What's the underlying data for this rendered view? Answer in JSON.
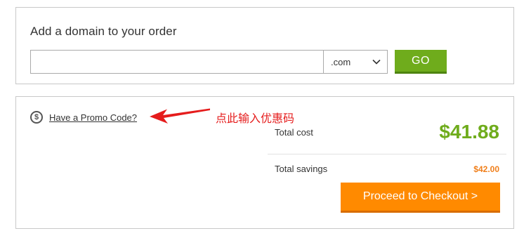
{
  "domain_search": {
    "heading": "Add a domain to your order",
    "input_value": "",
    "input_placeholder": "",
    "tld_selected": ".com",
    "go_label": "GO"
  },
  "summary": {
    "promo_icon": "dollar-circle-icon",
    "promo_link": "Have a Promo Code?",
    "annotation": "点此输入优惠码",
    "total_label": "Total cost",
    "total_value": "$41.88",
    "savings_label": "Total savings",
    "savings_value": "$42.00",
    "checkout_label": "Proceed to Checkout >"
  },
  "colors": {
    "go_green": "#6fac1c",
    "total_green": "#6fac1c",
    "savings_orange": "#f07f1b",
    "checkout_orange": "#ff8a00",
    "annotation_red": "#e51c1c"
  }
}
